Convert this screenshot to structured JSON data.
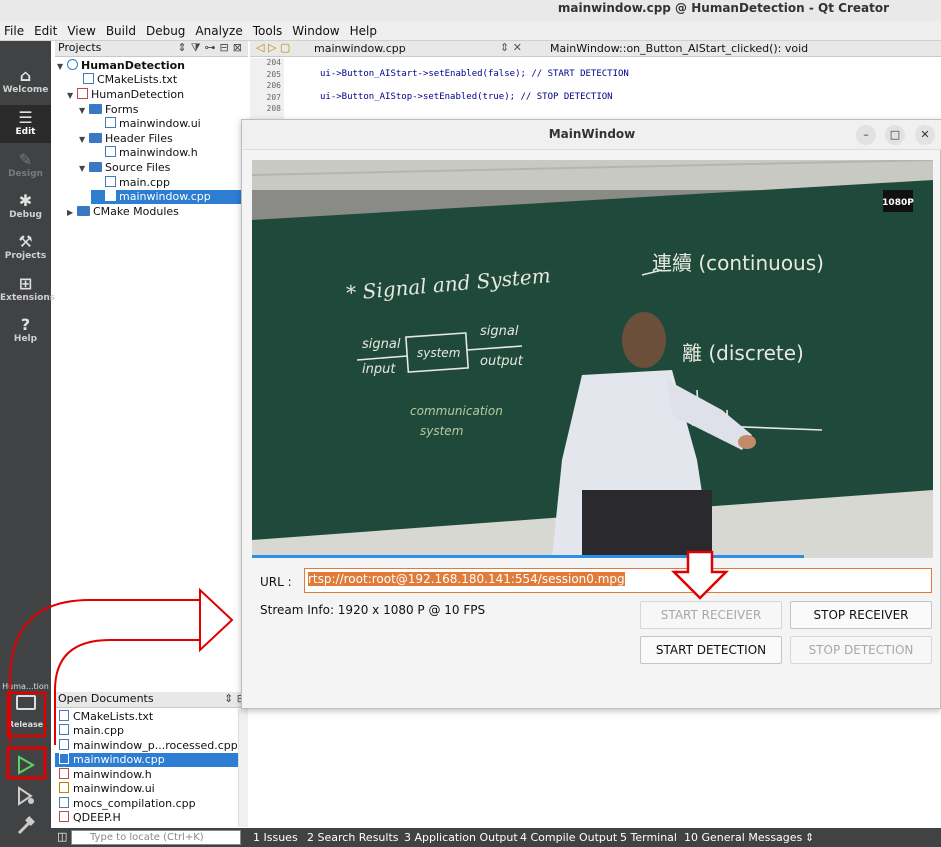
{
  "window": {
    "title": "mainwindow.cpp @ HumanDetection - Qt Creator"
  },
  "menu": [
    "File",
    "Edit",
    "View",
    "Build",
    "Debug",
    "Analyze",
    "Tools",
    "Window",
    "Help"
  ],
  "modes": [
    {
      "label": "Welcome",
      "icon": "home-icon"
    },
    {
      "label": "Edit",
      "icon": "edit-icon"
    },
    {
      "label": "Design",
      "icon": "design-icon"
    },
    {
      "label": "Debug",
      "icon": "debug-icon"
    },
    {
      "label": "Projects",
      "icon": "wrench-icon"
    },
    {
      "label": "Extensions",
      "icon": "extensions-icon"
    },
    {
      "label": "Help",
      "icon": "help-icon"
    }
  ],
  "projects": {
    "header": "Projects",
    "tree": [
      {
        "label": "HumanDetection"
      },
      {
        "label": "CMakeLists.txt"
      },
      {
        "label": "HumanDetection"
      },
      {
        "label": "Forms"
      },
      {
        "label": "mainwindow.ui"
      },
      {
        "label": "Header Files"
      },
      {
        "label": "mainwindow.h"
      },
      {
        "label": "Source Files"
      },
      {
        "label": "main.cpp"
      },
      {
        "label": "mainwindow.cpp"
      },
      {
        "label": "CMake Modules"
      }
    ]
  },
  "editor": {
    "file_tab": "mainwindow.cpp",
    "function": "MainWindow::on_Button_AIStart_clicked(): void",
    "line_numbers": [
      "204",
      "205",
      "206",
      "207",
      "208"
    ],
    "line1": "ui->Button_AIStart->setEnabled(false); // START DETECTION",
    "line2": "ui->Button_AIStop->setEnabled(true); // STOP DETECTION"
  },
  "open_documents": {
    "header": "Open Documents",
    "items": [
      {
        "label": "CMakeLists.txt"
      },
      {
        "label": "main.cpp"
      },
      {
        "label": "mainwindow_p...rocessed.cpp"
      },
      {
        "label": "mainwindow.cpp"
      },
      {
        "label": "mainwindow.h"
      },
      {
        "label": "mainwindow.ui"
      },
      {
        "label": "mocs_compilation.cpp"
      },
      {
        "label": "QDEEP.H"
      }
    ]
  },
  "kit": {
    "name": "Huma...tion",
    "build": "Release"
  },
  "statusbar": {
    "locate_placeholder": "Type to locate (Ctrl+K)",
    "tabs": [
      "1 Issues",
      "2 Search Results",
      "3 Application Output",
      "4 Compile Output",
      "5 Terminal",
      "10 General Messages"
    ]
  },
  "dialog": {
    "title": "MainWindow",
    "video_badge": "1080P",
    "progress": 0.81,
    "url_label": "URL :",
    "url_value": "rtsp://root:root@192.168.180.141:554/session0.mpg",
    "stream_info": "Stream Info: 1920 x 1080 P  @ 10 FPS",
    "buttons": {
      "start_receiver": "START RECEIVER",
      "stop_receiver": "STOP RECEIVER",
      "start_detection": "START DETECTION",
      "stop_detection": "STOP DETECTION"
    }
  },
  "colors": {
    "accent": "#2d7dd2",
    "annotation": "#e00000",
    "url_highlight": "#e07b3a"
  }
}
